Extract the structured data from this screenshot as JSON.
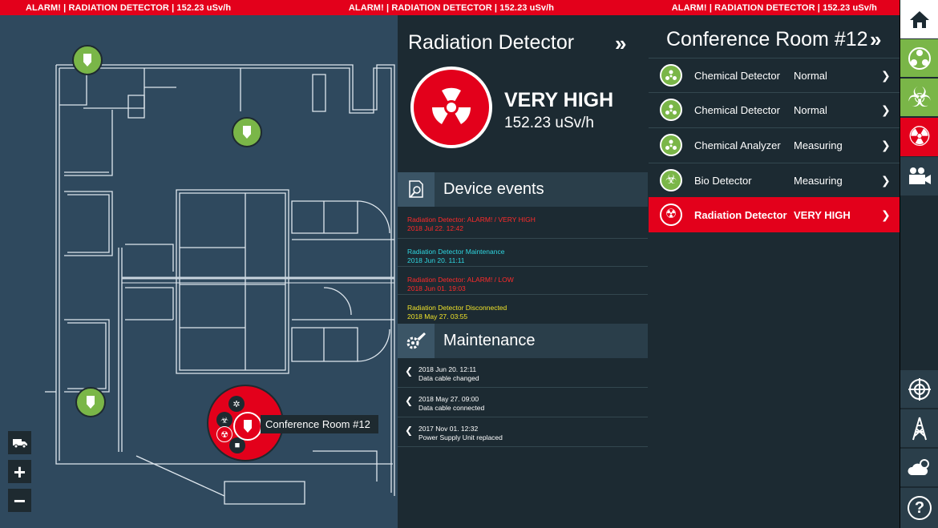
{
  "alarm_bar": {
    "left": "ALARM! | RADIATION DETECTOR | 152.23 uSv/h",
    "center": "ALARM! | RADIATION DETECTOR | 152.23 uSv/h",
    "right": "ALARM! | RADIATION DETECTOR | 152.23 uSv/h"
  },
  "map": {
    "room_label": "Conference Room #12",
    "zoom_in": "+",
    "zoom_out": "−",
    "pin_color_ok": "#7ab648",
    "pin_color_alarm": "#e3001b"
  },
  "detector": {
    "title": "Radiation Detector",
    "collapse": "»",
    "level": "VERY HIGH",
    "value": "152.23 uSv/h",
    "events_title": "Device events",
    "events": [
      {
        "line1": "Radiation Detector: ALARM! / VERY HIGH",
        "line2": "2018 Jul 22. 12:42"
      },
      {
        "line1": "Radiation Detector  Maintenance",
        "line2": "2018 Jun 20. 11:11"
      },
      {
        "line1": "Radiation Detector: ALARM!  / LOW",
        "line2": "2018 Jun 01. 19:03"
      },
      {
        "line1": "Radiation Detector  Disconnected",
        "line2": "2018 May 27. 03:55"
      }
    ],
    "maintenance_title": "Maintenance",
    "maintenance": [
      {
        "date": "2018 Jun 20. 12:11",
        "text": "Data cable changed"
      },
      {
        "date": "2018 May 27. 09:00",
        "text": "Data cable connected"
      },
      {
        "date": "2017 Nov 01. 12:32",
        "text": "Power Supply Unit replaced"
      }
    ],
    "chevron_left": "❮"
  },
  "room": {
    "title": "Conference Room #12",
    "collapse": "»",
    "chevron_right": "❯",
    "devices": [
      {
        "name": "Chemical Detector",
        "status": "Normal"
      },
      {
        "name": "Chemical Detector",
        "status": "Normal"
      },
      {
        "name": "Chemical Analyzer",
        "status": "Measuring"
      },
      {
        "name": "Bio Detector",
        "status": "Measuring"
      },
      {
        "name": "Radiation Detector",
        "status": "VERY HIGH"
      }
    ]
  },
  "toolbar": {
    "help": "?",
    "accent_green": "#7ab648",
    "accent_red": "#e3001b"
  }
}
